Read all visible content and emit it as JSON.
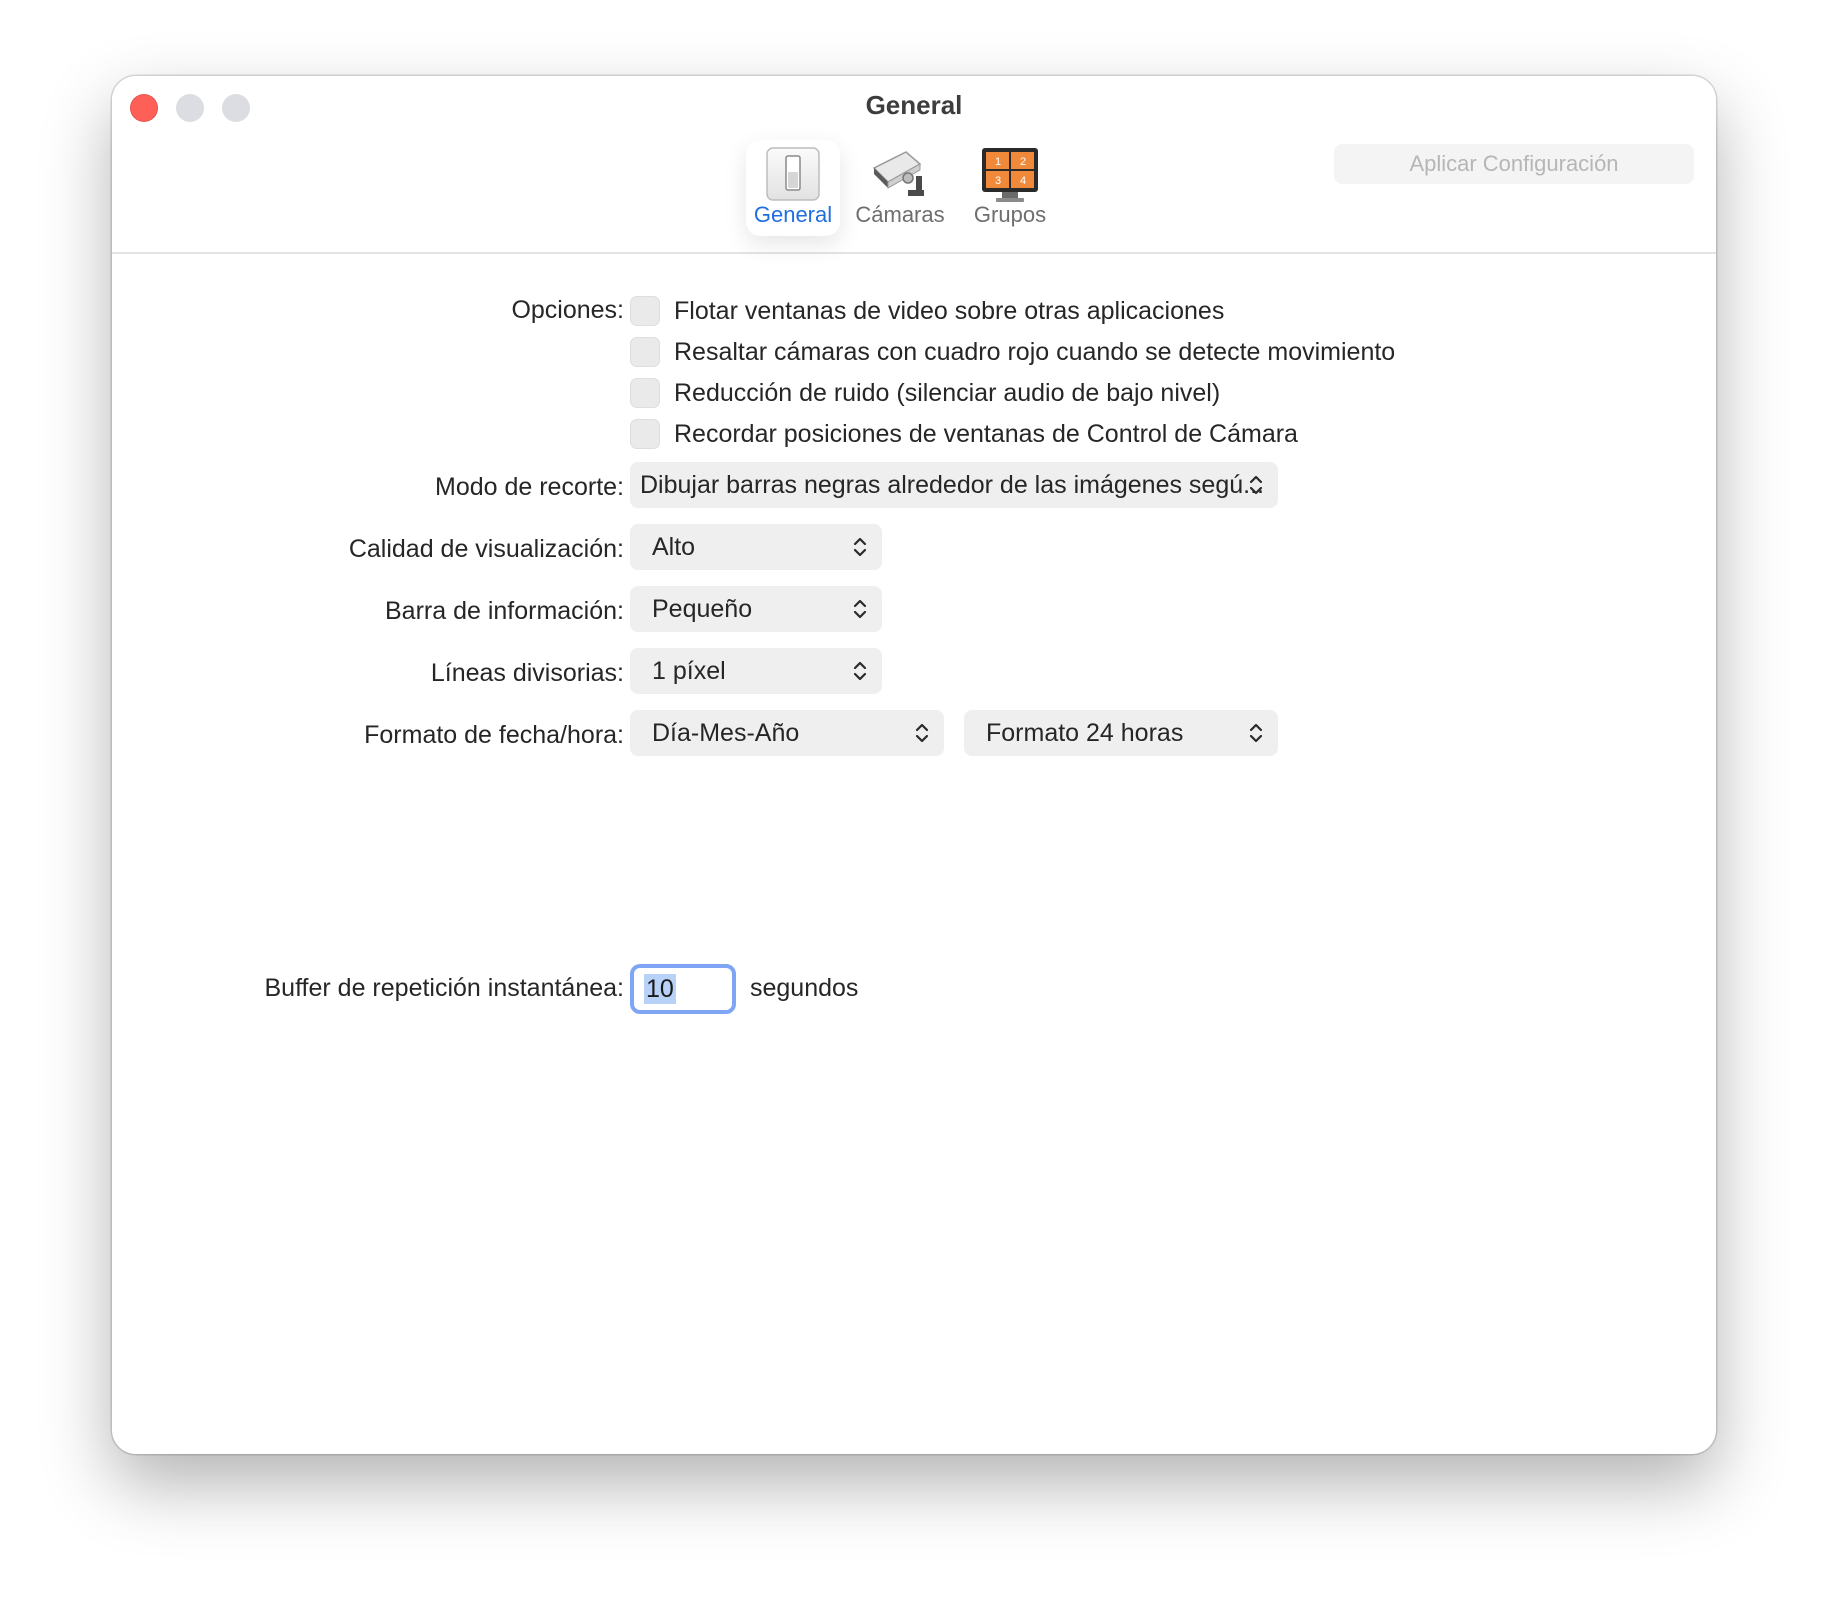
{
  "window": {
    "title": "General"
  },
  "toolbar": {
    "tabs": [
      {
        "label": "General",
        "icon": "switch-icon",
        "selected": true
      },
      {
        "label": "Cámaras",
        "icon": "security-camera-icon",
        "selected": false
      },
      {
        "label": "Grupos",
        "icon": "camera-grid-monitor-icon",
        "selected": false
      }
    ],
    "apply_label": "Aplicar Configuración"
  },
  "form": {
    "options": {
      "label": "Opciones:",
      "items": [
        {
          "label": "Flotar ventanas de video sobre otras aplicaciones",
          "checked": false
        },
        {
          "label": "Resaltar cámaras con cuadro rojo cuando se detecte movimiento",
          "checked": false
        },
        {
          "label": "Reducción de ruido (silenciar audio de bajo nivel)",
          "checked": false
        },
        {
          "label": "Recordar posiciones de ventanas de Control de Cámara",
          "checked": false
        }
      ]
    },
    "crop_mode": {
      "label": "Modo de recorte:",
      "value": "Dibujar barras negras alrededor de las imágenes segú..."
    },
    "display_quality": {
      "label": "Calidad de visualización:",
      "value": "Alto"
    },
    "info_bar": {
      "label": "Barra de información:",
      "value": "Pequeño"
    },
    "divider_lines": {
      "label": "Líneas divisorias:",
      "value": "1 píxel"
    },
    "datetime_format": {
      "label": "Formato de fecha/hora:",
      "date_value": "Día-Mes-Año",
      "time_value": "Formato 24 horas"
    },
    "replay_buffer": {
      "label": "Buffer de repetición instantánea:",
      "value": "10",
      "unit": "segundos"
    }
  },
  "colors": {
    "accent": "#1f6fe0",
    "close": "#fe5f57",
    "focus_ring": "#7ea6f4"
  }
}
